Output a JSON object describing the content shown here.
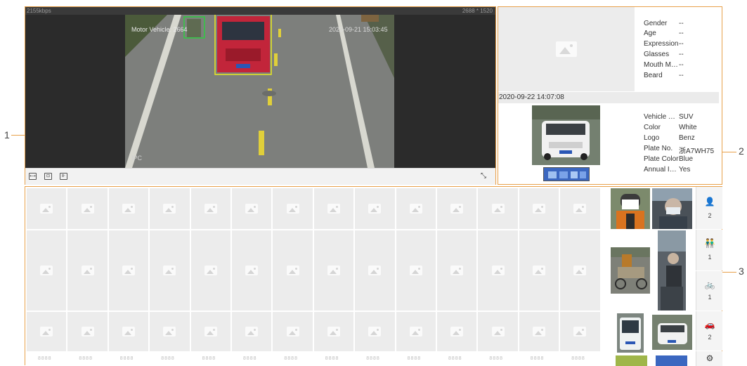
{
  "callouts": {
    "one": "1",
    "two": "2",
    "three": "3"
  },
  "live_view": {
    "bitrate": "2155kbps",
    "resolution": "2688 * 1520",
    "overlay_label": "Motor Vehicle: 2664",
    "timestamp": "2020-09-21 15:03:45",
    "camera_tag": "IPC",
    "controls": [
      "fit-icon",
      "zoom-icon",
      "rule-icon"
    ],
    "fullscreen_icon": "fullscreen-icon"
  },
  "face_attributes": [
    {
      "key": "Gender",
      "value": "--"
    },
    {
      "key": "Age",
      "value": "--"
    },
    {
      "key": "Expression",
      "value": "--"
    },
    {
      "key": "Glasses",
      "value": "--"
    },
    {
      "key": "Mouth Ma...",
      "value": "--"
    },
    {
      "key": "Beard",
      "value": "--"
    }
  ],
  "capture_time": "2020-09-22 14:07:08",
  "vehicle_attributes": [
    {
      "key": "Vehicle Ty...",
      "value": "SUV"
    },
    {
      "key": "Color",
      "value": "White"
    },
    {
      "key": "Logo",
      "value": "Benz"
    },
    {
      "key": "Plate No.",
      "value": "浙A7WH75"
    },
    {
      "key": "Plate Color",
      "value": "Blue"
    },
    {
      "key": "Annual Ins...",
      "value": "Yes"
    }
  ],
  "grid": {
    "placeholder_text": "8888",
    "categories": [
      {
        "icon": "person-icon",
        "count": "2"
      },
      {
        "icon": "non-motor-icon",
        "count": "1"
      },
      {
        "icon": "bicycle-icon",
        "count": "1"
      },
      {
        "icon": "car-icon",
        "count": "2"
      },
      {
        "icon": "settings-icon",
        "count": ""
      }
    ]
  },
  "colors": {
    "accent": "#e8a04a",
    "box_green": "#2ecc40",
    "box_yellow": "#e8e820"
  }
}
